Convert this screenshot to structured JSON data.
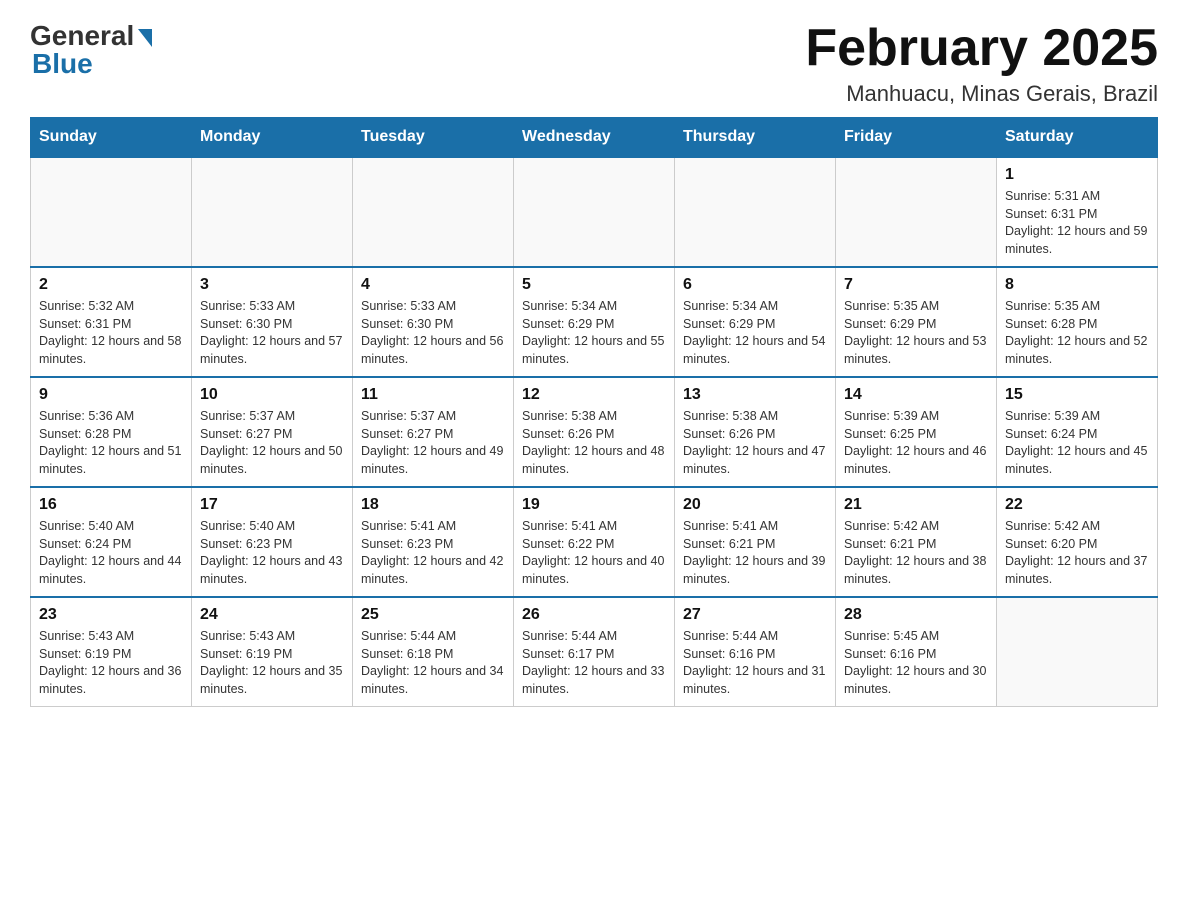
{
  "header": {
    "logo_general": "General",
    "logo_blue": "Blue",
    "month_title": "February 2025",
    "location": "Manhuacu, Minas Gerais, Brazil"
  },
  "days_of_week": [
    "Sunday",
    "Monday",
    "Tuesday",
    "Wednesday",
    "Thursday",
    "Friday",
    "Saturday"
  ],
  "weeks": [
    [
      {
        "day": "",
        "info": ""
      },
      {
        "day": "",
        "info": ""
      },
      {
        "day": "",
        "info": ""
      },
      {
        "day": "",
        "info": ""
      },
      {
        "day": "",
        "info": ""
      },
      {
        "day": "",
        "info": ""
      },
      {
        "day": "1",
        "info": "Sunrise: 5:31 AM\nSunset: 6:31 PM\nDaylight: 12 hours and 59 minutes."
      }
    ],
    [
      {
        "day": "2",
        "info": "Sunrise: 5:32 AM\nSunset: 6:31 PM\nDaylight: 12 hours and 58 minutes."
      },
      {
        "day": "3",
        "info": "Sunrise: 5:33 AM\nSunset: 6:30 PM\nDaylight: 12 hours and 57 minutes."
      },
      {
        "day": "4",
        "info": "Sunrise: 5:33 AM\nSunset: 6:30 PM\nDaylight: 12 hours and 56 minutes."
      },
      {
        "day": "5",
        "info": "Sunrise: 5:34 AM\nSunset: 6:29 PM\nDaylight: 12 hours and 55 minutes."
      },
      {
        "day": "6",
        "info": "Sunrise: 5:34 AM\nSunset: 6:29 PM\nDaylight: 12 hours and 54 minutes."
      },
      {
        "day": "7",
        "info": "Sunrise: 5:35 AM\nSunset: 6:29 PM\nDaylight: 12 hours and 53 minutes."
      },
      {
        "day": "8",
        "info": "Sunrise: 5:35 AM\nSunset: 6:28 PM\nDaylight: 12 hours and 52 minutes."
      }
    ],
    [
      {
        "day": "9",
        "info": "Sunrise: 5:36 AM\nSunset: 6:28 PM\nDaylight: 12 hours and 51 minutes."
      },
      {
        "day": "10",
        "info": "Sunrise: 5:37 AM\nSunset: 6:27 PM\nDaylight: 12 hours and 50 minutes."
      },
      {
        "day": "11",
        "info": "Sunrise: 5:37 AM\nSunset: 6:27 PM\nDaylight: 12 hours and 49 minutes."
      },
      {
        "day": "12",
        "info": "Sunrise: 5:38 AM\nSunset: 6:26 PM\nDaylight: 12 hours and 48 minutes."
      },
      {
        "day": "13",
        "info": "Sunrise: 5:38 AM\nSunset: 6:26 PM\nDaylight: 12 hours and 47 minutes."
      },
      {
        "day": "14",
        "info": "Sunrise: 5:39 AM\nSunset: 6:25 PM\nDaylight: 12 hours and 46 minutes."
      },
      {
        "day": "15",
        "info": "Sunrise: 5:39 AM\nSunset: 6:24 PM\nDaylight: 12 hours and 45 minutes."
      }
    ],
    [
      {
        "day": "16",
        "info": "Sunrise: 5:40 AM\nSunset: 6:24 PM\nDaylight: 12 hours and 44 minutes."
      },
      {
        "day": "17",
        "info": "Sunrise: 5:40 AM\nSunset: 6:23 PM\nDaylight: 12 hours and 43 minutes."
      },
      {
        "day": "18",
        "info": "Sunrise: 5:41 AM\nSunset: 6:23 PM\nDaylight: 12 hours and 42 minutes."
      },
      {
        "day": "19",
        "info": "Sunrise: 5:41 AM\nSunset: 6:22 PM\nDaylight: 12 hours and 40 minutes."
      },
      {
        "day": "20",
        "info": "Sunrise: 5:41 AM\nSunset: 6:21 PM\nDaylight: 12 hours and 39 minutes."
      },
      {
        "day": "21",
        "info": "Sunrise: 5:42 AM\nSunset: 6:21 PM\nDaylight: 12 hours and 38 minutes."
      },
      {
        "day": "22",
        "info": "Sunrise: 5:42 AM\nSunset: 6:20 PM\nDaylight: 12 hours and 37 minutes."
      }
    ],
    [
      {
        "day": "23",
        "info": "Sunrise: 5:43 AM\nSunset: 6:19 PM\nDaylight: 12 hours and 36 minutes."
      },
      {
        "day": "24",
        "info": "Sunrise: 5:43 AM\nSunset: 6:19 PM\nDaylight: 12 hours and 35 minutes."
      },
      {
        "day": "25",
        "info": "Sunrise: 5:44 AM\nSunset: 6:18 PM\nDaylight: 12 hours and 34 minutes."
      },
      {
        "day": "26",
        "info": "Sunrise: 5:44 AM\nSunset: 6:17 PM\nDaylight: 12 hours and 33 minutes."
      },
      {
        "day": "27",
        "info": "Sunrise: 5:44 AM\nSunset: 6:16 PM\nDaylight: 12 hours and 31 minutes."
      },
      {
        "day": "28",
        "info": "Sunrise: 5:45 AM\nSunset: 6:16 PM\nDaylight: 12 hours and 30 minutes."
      },
      {
        "day": "",
        "info": ""
      }
    ]
  ]
}
